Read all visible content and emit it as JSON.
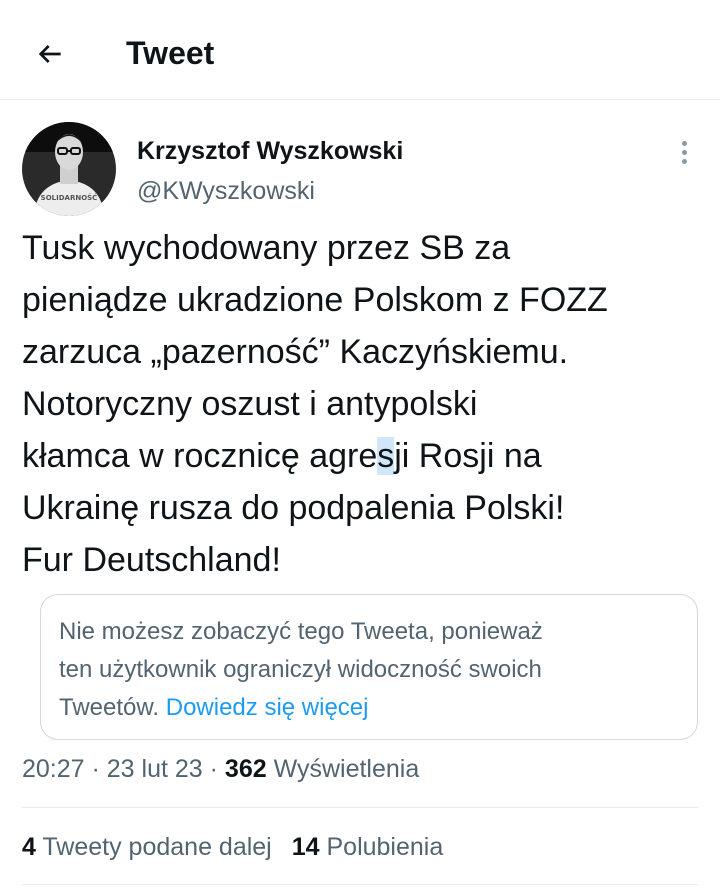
{
  "header": {
    "title": "Tweet"
  },
  "author": {
    "name": "Krzysztof Wyszkowski",
    "handle": "@KWyszkowski",
    "avatar_shirt_text": "SOLIDARNOŚĆ"
  },
  "tweet": {
    "lines": [
      "Tusk wychodowany przez SB za",
      "pieniądze ukradzione Polskom z FOZZ",
      "zarzuca „pazerność” Kaczyńskiemu.",
      "Notoryczny oszust i antypolski"
    ],
    "line5_before": "kłamca w rocznicę agre",
    "line5_selected": "s",
    "line5_after": "ji Rosji na",
    "line6": "Ukrainę rusza do podpalenia Polski!",
    "line7": "Fur Deutschland!"
  },
  "notice": {
    "line1": "Nie możesz zobaczyć tego Tweeta, ponieważ",
    "line2": "ten użytkownik ograniczył widoczność swoich",
    "line3_prefix": "Tweetów. ",
    "link": "Dowiedz się więcej"
  },
  "meta": {
    "time": "20:27",
    "sep": " · ",
    "date": "23 lut 23",
    "views_count": "362",
    "views_label": " Wyświetlenia"
  },
  "stats": {
    "retweets_count": "4",
    "retweets_label": " Tweety podane dalej",
    "likes_count": "14",
    "likes_label": " Polubienia"
  },
  "colors": {
    "text": "#0f1419",
    "secondary": "#536471",
    "link": "#1d9bf0",
    "border": "#cfd9de",
    "selection": "#cfe6fb"
  },
  "icons": [
    "back-arrow-icon",
    "more-options-icon"
  ]
}
